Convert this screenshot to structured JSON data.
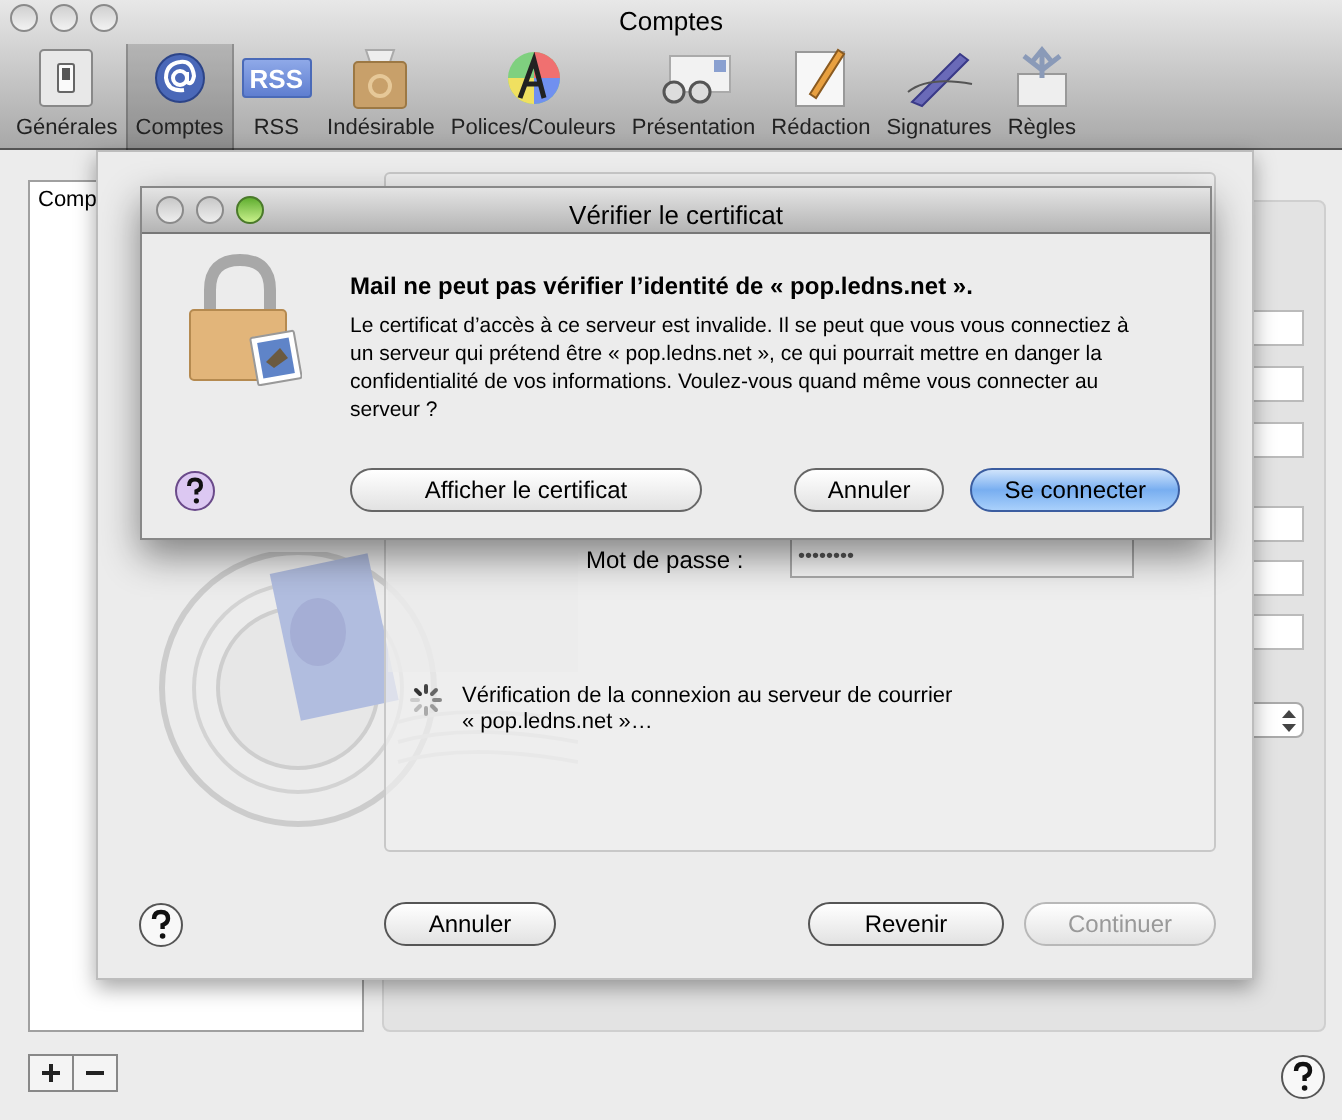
{
  "window": {
    "title": "Comptes"
  },
  "toolbar": [
    {
      "label": "Générales",
      "kind": "switch",
      "selected": false
    },
    {
      "label": "Comptes",
      "kind": "at",
      "selected": true
    },
    {
      "label": "RSS",
      "kind": "rss",
      "selected": false,
      "badge": "RSS"
    },
    {
      "label": "Indésirable",
      "kind": "junk",
      "selected": false
    },
    {
      "label": "Polices/Couleurs",
      "kind": "fonts",
      "selected": false
    },
    {
      "label": "Présentation",
      "kind": "viewing",
      "selected": false
    },
    {
      "label": "Rédaction",
      "kind": "composing",
      "selected": false
    },
    {
      "label": "Signatures",
      "kind": "signatures",
      "selected": false
    },
    {
      "label": "Règles",
      "kind": "rules",
      "selected": false
    }
  ],
  "accounts_list": {
    "header": "Comp"
  },
  "assistant": {
    "password_label": "Mot de passe :",
    "password_value": "••••••••",
    "status_lines": [
      "Vérification de la connexion au serveur de courrier",
      "« pop.ledns.net »…"
    ],
    "buttons": [
      {
        "label": "Annuler",
        "disabled": false
      },
      {
        "label": "Revenir",
        "disabled": false
      },
      {
        "label": "Continuer",
        "disabled": true
      }
    ]
  },
  "dialog": {
    "title": "Vérifier le certificat",
    "heading": "Mail ne peut pas vérifier l’identité de « pop.ledns.net ».",
    "message": "Le certificat d’accès à ce serveur est invalide. Il se peut que vous vous connectiez à un serveur qui prétend être « pop.ledns.net », ce qui pourrait mettre en danger la confidentialité de vos informations. Voulez-vous quand même vous connecter au serveur ?",
    "buttons": [
      {
        "label": "Afficher le certificat",
        "default": false
      },
      {
        "label": "Annuler",
        "default": false
      },
      {
        "label": "Se connecter",
        "default": true
      }
    ]
  }
}
